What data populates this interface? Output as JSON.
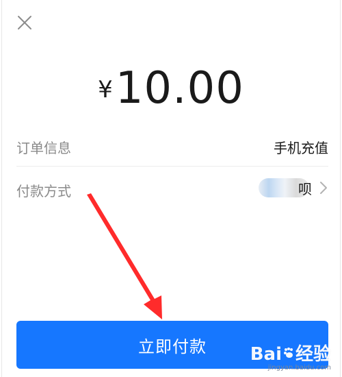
{
  "header": {
    "close_icon": "close-icon"
  },
  "payment": {
    "currency_symbol": "¥",
    "amount": "10.00"
  },
  "details": {
    "order_label": "订单信息",
    "order_value": "手机充值",
    "method_label": "付款方式",
    "method_value_visible": "呗",
    "method_arrow_icon": "chevron-right-icon"
  },
  "actions": {
    "pay_button": "立即付款"
  },
  "watermark": {
    "logo": "Baidu经验",
    "url": "jingyan.baidu.com"
  },
  "colors": {
    "primary": "#1677FF",
    "text_primary": "#1A1A1A",
    "text_secondary": "#8A8A8A",
    "annotation_red": "#FF2B2B",
    "divider": "#ECECEC"
  }
}
